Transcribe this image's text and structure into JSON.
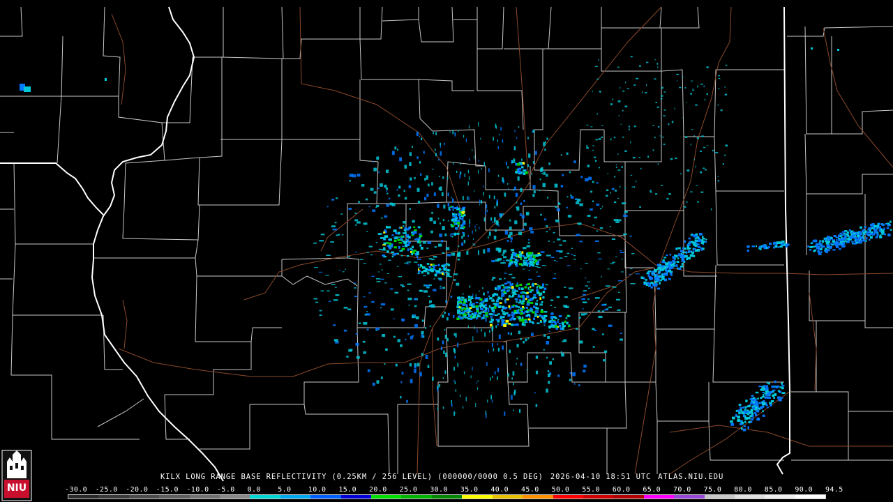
{
  "caption": {
    "product": "KILX LONG RANGE BASE REFLECTIVITY (0.25KM / 256 LEVEL) (000000/0000 0.5 DEG)",
    "timestamp": "2026-04-10 18:51 UTC",
    "site": "ATLAS.NIU.EDU"
  },
  "logo": {
    "text": "NIU"
  },
  "legend": {
    "labels": [
      "-30.0",
      "-25.0",
      "-20.0",
      "-15.0",
      "-10.0",
      "-5.0",
      "0.0",
      "5.0",
      "10.0",
      "15.0",
      "20.0",
      "25.0",
      "30.0",
      "35.0",
      "40.0",
      "45.0",
      "50.0",
      "55.0",
      "60.0",
      "65.0",
      "70.0",
      "75.0",
      "80.0",
      "85.0",
      "90.0",
      "94.5"
    ],
    "colors": [
      "#2a2a2a",
      "#3a3a3a",
      "#4c4c4c",
      "#5e5e5e",
      "#727272",
      "#888888",
      "#00d8d8",
      "#00a8f0",
      "#0060ff",
      "#0000d8",
      "#00e000",
      "#00b400",
      "#008800",
      "#ffff00",
      "#e8c000",
      "#ff9000",
      "#ff0000",
      "#d00000",
      "#b00000",
      "#ff00ff",
      "#9848d8",
      "#c8c8c8",
      "#e0e0e0",
      "#f0f0f0",
      "#ffffff"
    ]
  },
  "colors": {
    "background": "#000000",
    "county_lines": "#c8c8c8",
    "state_lines": "#ffffff",
    "highways": "#8b4a2b",
    "echo_light": "#00c8d8",
    "echo_mid": "#0078ff",
    "echo_strong": "#00d000",
    "echo_peak": "#f0f000"
  }
}
